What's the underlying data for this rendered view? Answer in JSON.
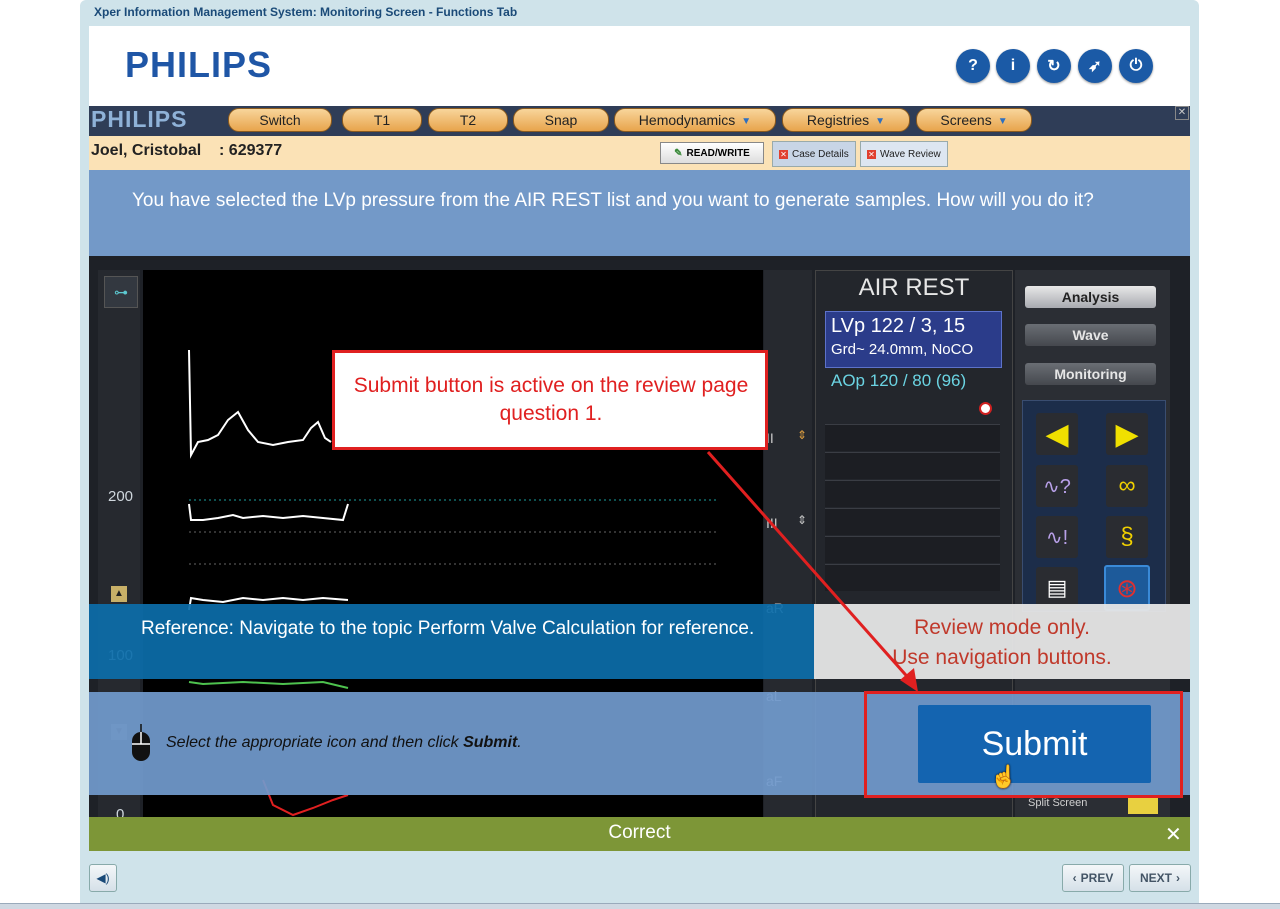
{
  "window": {
    "title": "Xper Information Management System: Monitoring Screen - Functions Tab"
  },
  "brand": {
    "logo": "PHILIPS"
  },
  "header_buttons": [
    {
      "icon": "help-icon",
      "glyph": "?"
    },
    {
      "icon": "info-icon",
      "glyph": "i"
    },
    {
      "icon": "refresh-icon",
      "glyph": "↻"
    },
    {
      "icon": "compass-icon",
      "glyph": "➶"
    },
    {
      "icon": "power-icon",
      "glyph": "⏻"
    }
  ],
  "app": {
    "logo": "PHILIPS",
    "tabs": [
      "Switch",
      "T1",
      "T2",
      "Snap",
      "Hemodynamics",
      "Registries",
      "Screens"
    ],
    "patient": "Joel, Cristobal    : 629377",
    "read_write": "READ/WRITE",
    "subtabs": [
      "Case Details",
      "Wave Review"
    ]
  },
  "question": "You have selected the LVp pressure from the AIR REST list and you want to generate samples. How will you do it?",
  "monitor": {
    "y_labels": [
      "200",
      "100",
      "0"
    ],
    "strip_labels": [
      "II",
      "III",
      "aR",
      "aL",
      "aF"
    ],
    "air_title": "AIR REST",
    "lvp_line1": "LVp 122 / 3, 15",
    "lvp_line2": "Grd~ 24.0mm, NoCO",
    "aop_line": "AOp 120 / 80 (96)",
    "ctrl_buttons": [
      "Analysis",
      "Wave",
      "Monitoring"
    ],
    "split_screen": "Split Screen"
  },
  "callout": "Submit button is active on the review page question 1.",
  "reference": "Reference: Navigate to the topic Perform Valve Calculation for reference.",
  "review_mode": {
    "line1": "Review mode only.",
    "line2": "Use navigation buttons."
  },
  "instruction": {
    "prefix": "Select the appropriate icon and then click ",
    "bold": "Submit",
    "suffix": "."
  },
  "submit_label": "Submit",
  "result": "Correct",
  "nav": {
    "prev": "PREV",
    "next": "NEXT"
  },
  "colors": {
    "accent": "#1464b0",
    "correct": "#7d9637",
    "callout": "#e02020"
  }
}
